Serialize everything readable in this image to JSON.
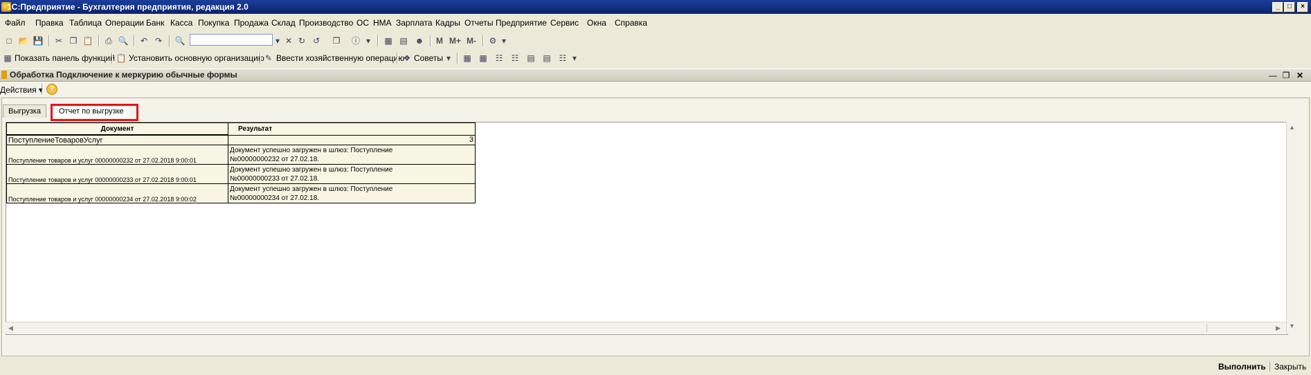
{
  "window": {
    "title": "1С:Предприятие - Бухгалтерия предприятия, редакция 2.0",
    "controls": [
      "_",
      "□",
      "×"
    ]
  },
  "menu": [
    "Файл",
    "Правка",
    "Таблица",
    "Операции",
    "Банк",
    "Касса",
    "Покупка",
    "Продажа",
    "Склад",
    "Производство",
    "ОС",
    "НМА",
    "Зарплата",
    "Кадры",
    "Отчеты",
    "Предприятие",
    "Сервис",
    "Окна",
    "Справка"
  ],
  "toolbar2": {
    "show_panel": "Показать панель функций",
    "set_org": "Установить основную организацию",
    "enter_op": "Ввести хозяйственную операцию",
    "tips": "Советы",
    "mplus": "M+",
    "mminus": "M-",
    "m": "M"
  },
  "subwindow": {
    "title": "Обработка  Подключение к меркурию обычные формы",
    "actions": "Действия",
    "help": "?"
  },
  "tabs": [
    {
      "label": "Выгрузка",
      "active": false
    },
    {
      "label": "Отчет по выгрузке",
      "active": true
    }
  ],
  "report": {
    "headers": [
      "Документ",
      "Результат"
    ],
    "group": {
      "name": "ПоступлениеТоваровУслуг",
      "count": "3"
    },
    "rows": [
      {
        "doc": "Поступление товаров и услуг 00000000232 от 27.02.2018 9:00:01",
        "result_line1": "Документ успешно загружен в шлюз: Поступление",
        "result_line2": "№00000000232 от 27.02.18."
      },
      {
        "doc": "Поступление товаров и услуг 00000000233 от 27.02.2018 9:00:01",
        "result_line1": "Документ успешно загружен в шлюз: Поступление",
        "result_line2": "№00000000233 от 27.02.18."
      },
      {
        "doc": "Поступление товаров и услуг 00000000234 от 27.02.2018 9:00:02",
        "result_line1": "Документ успешно загружен в шлюз: Поступление",
        "result_line2": "№00000000234 от 27.02.18."
      }
    ]
  },
  "footer": {
    "run": "Выполнить",
    "close": "Закрыть"
  },
  "colors": {
    "title_bar": "#0a246a",
    "highlight": "#e8101c",
    "report_cell": "#f8f6e2"
  }
}
